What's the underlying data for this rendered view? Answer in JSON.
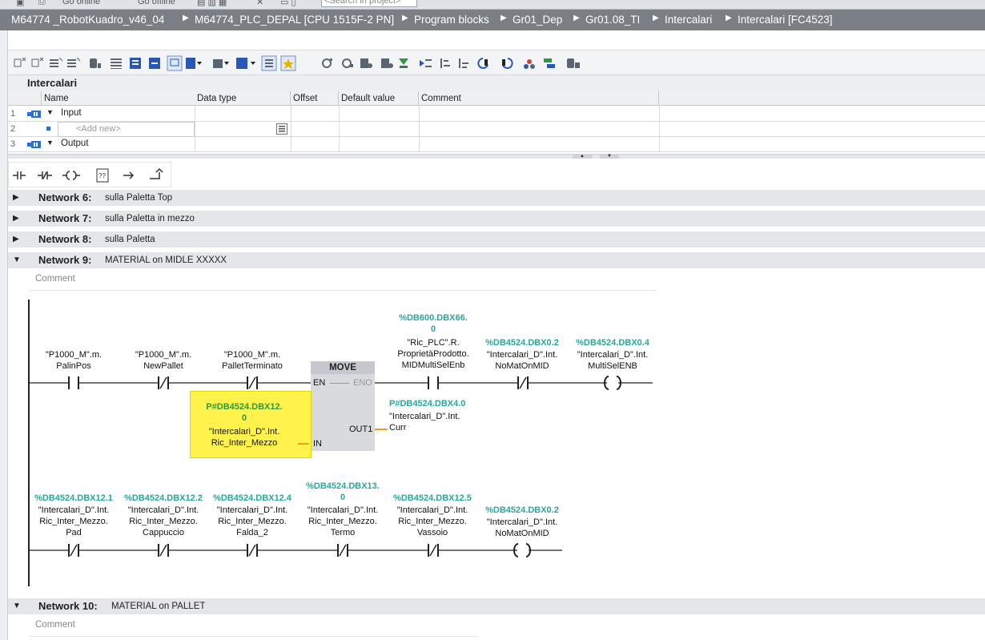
{
  "topstrip": {
    "go_online": "Go online",
    "go_offline": "Go offline",
    "search_placeholder": "<Search in project>"
  },
  "breadcrumb": [
    "M64774 _RobotKuadro_v46_04",
    "M64774_PLC_DEPAL [CPU 1515F-2 PN]",
    "Program blocks",
    "Gr01_Dep",
    "Gr01.08_TI",
    "Intercalari",
    "Intercalari [FC4523]"
  ],
  "interface": {
    "title": "Intercalari",
    "columns": [
      "Name",
      "Data type",
      "Offset",
      "Default value",
      "Comment"
    ],
    "rows": [
      {
        "num": "1",
        "name": "Input"
      },
      {
        "num": "2",
        "name": "<Add new>"
      },
      {
        "num": "3",
        "name": "Output"
      }
    ]
  },
  "networks": [
    {
      "label": "Network 6:",
      "title": "sulla Paletta Top"
    },
    {
      "label": "Network 7:",
      "title": "sulla Paletta in mezzo"
    },
    {
      "label": "Network 8:",
      "title": "sulla Paletta"
    },
    {
      "label": "Network 9:",
      "title": "MATERIAL on MIDLE  XXXXX",
      "comment": "Comment"
    },
    {
      "label": "Network 10:",
      "title": "MATERIAL on PALLET",
      "comment": "Comment"
    }
  ],
  "net9": {
    "rung1": {
      "c1": {
        "addr": "",
        "l1": "\"P1000_M\".m.",
        "l2": "PalinPos"
      },
      "c2": {
        "addr": "",
        "l1": "\"P1000_M\".m.",
        "l2": "NewPallet"
      },
      "c3": {
        "addr": "",
        "l1": "\"P1000_M\".m.",
        "l2": "PalletTerminato"
      },
      "c4": {
        "addr1": "%DB600.DBX66.",
        "addr2": "0",
        "l1": "\"Ric_PLC\".R.",
        "l2": "ProprietàProdotto.",
        "l3": "MIDMultiSelEnb"
      },
      "c5": {
        "addr": "%DB4524.DBX0.2",
        "l1": "\"Intercalari_D\".Int.",
        "l2": "NoMatOnMID"
      },
      "coil": {
        "addr": "%DB4524.DBX0.4",
        "l1": "\"Intercalari_D\".Int.",
        "l2": "MultiSelENB"
      },
      "move": {
        "title": "MOVE",
        "en": "EN",
        "eno": "ENO",
        "out1": "OUT1",
        "in": "IN"
      },
      "in_op": {
        "addr1": "P#DB4524.DBX12.",
        "addr2": "0",
        "l1": "\"Intercalari_D\".Int.",
        "l2": "Ric_Inter_Mezzo"
      },
      "out_op": {
        "addr": "P#DB4524.DBX4.0",
        "l1": "\"Intercalari_D\".Int.",
        "l2": "Curr"
      }
    },
    "rung2": [
      {
        "addr": "%DB4524.DBX12.1",
        "l1": "\"Intercalari_D\".Int.",
        "l2": "Ric_Inter_Mezzo.",
        "l3": "Pad"
      },
      {
        "addr": "%DB4524.DBX12.2",
        "l1": "\"Intercalari_D\".Int.",
        "l2": "Ric_Inter_Mezzo.",
        "l3": "Cappuccio"
      },
      {
        "addr": "%DB4524.DBX12.4",
        "l1": "\"Intercalari_D\".Int.",
        "l2": "Ric_Inter_Mezzo.",
        "l3": "Falda_2"
      },
      {
        "addr1": "%DB4524.DBX13.",
        "addr2": "0",
        "l1": "\"Intercalari_D\".Int.",
        "l2": "Ric_Inter_Mezzo.",
        "l3": "Termo"
      },
      {
        "addr": "%DB4524.DBX12.5",
        "l1": "\"Intercalari_D\".Int.",
        "l2": "Ric_Inter_Mezzo.",
        "l3": "Vassoio"
      },
      {
        "addr": "%DB4524.DBX0.2",
        "l1": "\"Intercalari_D\".Int.",
        "l2": "NoMatOnMID"
      }
    ]
  },
  "colors": {
    "address_teal": "#2aa79d",
    "highlight": "#fff24a",
    "breadcrumb_bg": "#7a7f86"
  }
}
